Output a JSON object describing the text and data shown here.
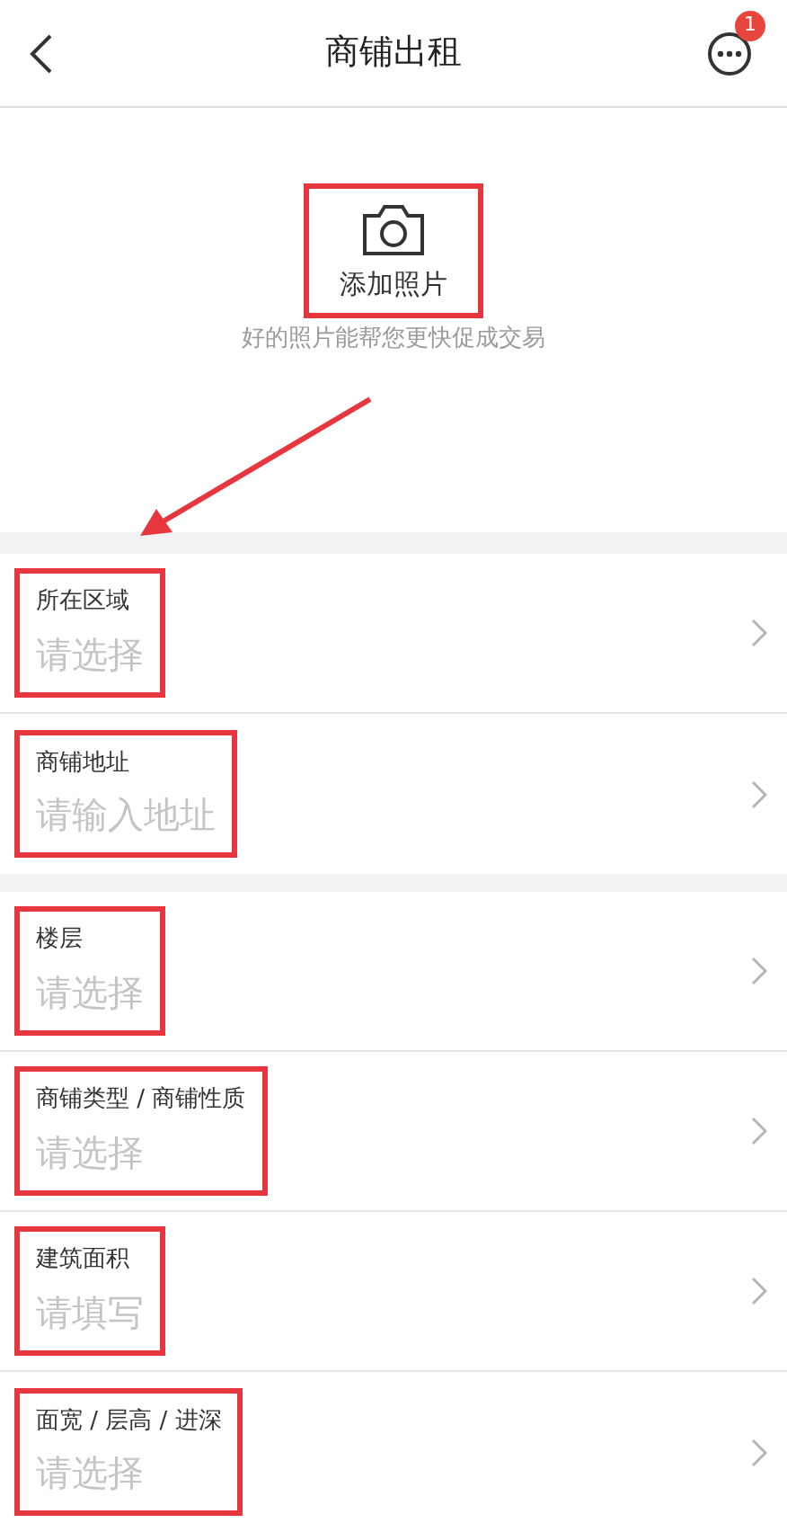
{
  "header": {
    "title": "商铺出租",
    "badge": "1"
  },
  "photo": {
    "button_label": "添加照片",
    "hint": "好的照片能帮您更快促成交易",
    "highlighted": true
  },
  "sections": [
    {
      "rows": [
        {
          "label": "所在区域",
          "placeholder": "请选择",
          "highlighted": true
        },
        {
          "label": "商铺地址",
          "placeholder": "请输入地址",
          "highlighted": true
        }
      ]
    },
    {
      "rows": [
        {
          "label": "楼层",
          "placeholder": "请选择",
          "highlighted": true
        },
        {
          "label": "商铺类型 / 商铺性质",
          "placeholder": "请选择",
          "highlighted": true
        },
        {
          "label": "建筑面积",
          "placeholder": "请填写",
          "highlighted": true
        },
        {
          "label": "面宽 / 层高 / 进深",
          "placeholder": "请选择",
          "highlighted": true
        }
      ]
    }
  ]
}
